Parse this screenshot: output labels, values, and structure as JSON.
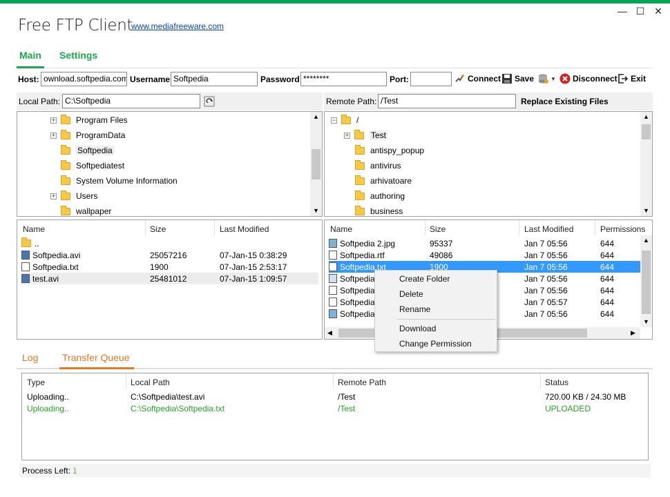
{
  "app": {
    "title": "Free FTP Client",
    "link": "www.mediafreeware.com"
  },
  "window": {
    "minimize": "—",
    "maximize": "☐",
    "close": "✕"
  },
  "tabs": [
    "Main",
    "Settings"
  ],
  "conn": {
    "host_label": "Host:",
    "host_value": "ownload.softpedia.com",
    "user_label": "Username:",
    "user_value": "Softpedia",
    "pass_label": "Password:",
    "pass_value": "********",
    "port_label": "Port:",
    "port_value": "",
    "connect": "Connect",
    "save": "Save",
    "disconnect": "Disconnect",
    "exit": "Exit"
  },
  "local": {
    "path_label": "Local Path:",
    "path_value": "C:\\Softpedia",
    "tree": [
      "Program Files",
      "ProgramData",
      "Softpedia",
      "Softpediatest",
      "System Volume Information",
      "Users",
      "wallpaper"
    ],
    "columns": [
      "Name",
      "Size",
      "Last Modified"
    ],
    "files": [
      {
        "name": "..",
        "size": "",
        "modified": ""
      },
      {
        "name": "Softpedia.avi",
        "size": "25057216",
        "modified": "07-Jan-15 0:38:29"
      },
      {
        "name": "Softpedia.txt",
        "size": "1900",
        "modified": "07-Jan-15 2:53:17"
      },
      {
        "name": "test.avi",
        "size": "25481012",
        "modified": "07-Jan-15 1:09:57"
      }
    ]
  },
  "remote": {
    "path_label": "Remote Path:",
    "path_value": "/Test",
    "replace_label": "Replace Existing Files",
    "tree": [
      "/",
      "Test",
      "antispy_popup",
      "antivirus",
      "arhivatoare",
      "authoring",
      "business"
    ],
    "columns": [
      "Name",
      "Size",
      "Last Modified",
      "Permissions"
    ],
    "files": [
      {
        "name": "Softpedia 2.jpg",
        "size": "95337",
        "modified": "Jan  7 05:56",
        "perm": "644"
      },
      {
        "name": "Softpedia.rtf",
        "size": "49086",
        "modified": "Jan  7 05:56",
        "perm": "644"
      },
      {
        "name": "Softpedia.txt",
        "size": "1900",
        "modified": "Jan  7 05:56",
        "perm": "644"
      },
      {
        "name": "Softpedia",
        "size": "",
        "modified": "Jan  7 05:56",
        "perm": "644"
      },
      {
        "name": "Softpedia",
        "size": "",
        "modified": "Jan  7 05:56",
        "perm": "644"
      },
      {
        "name": "Softpedia",
        "size": "",
        "modified": "Jan  7 05:57",
        "perm": "644"
      },
      {
        "name": "Softpedia",
        "size": "",
        "modified": "Jan  7 05:56",
        "perm": "644"
      }
    ]
  },
  "context_menu": [
    "Create Folder",
    "Delete",
    "Rename",
    "Download",
    "Change Permission"
  ],
  "bottom_tabs": [
    "Log",
    "Transfer Queue"
  ],
  "queue": {
    "columns": [
      "Type",
      "Local Path",
      "Remote Path",
      "Status"
    ],
    "rows": [
      {
        "type": "Uploading..",
        "local": "C:\\Softpedia\\test.avi",
        "remote": "/Test",
        "status": "720.00  KB / 24.30 MB"
      },
      {
        "type": "Uploading..",
        "local": "C:\\Softpedia\\Softpedia.txt",
        "remote": "/Test",
        "status": "UPLOADED"
      }
    ]
  },
  "process": {
    "label": "Process Left:",
    "value": "1"
  }
}
